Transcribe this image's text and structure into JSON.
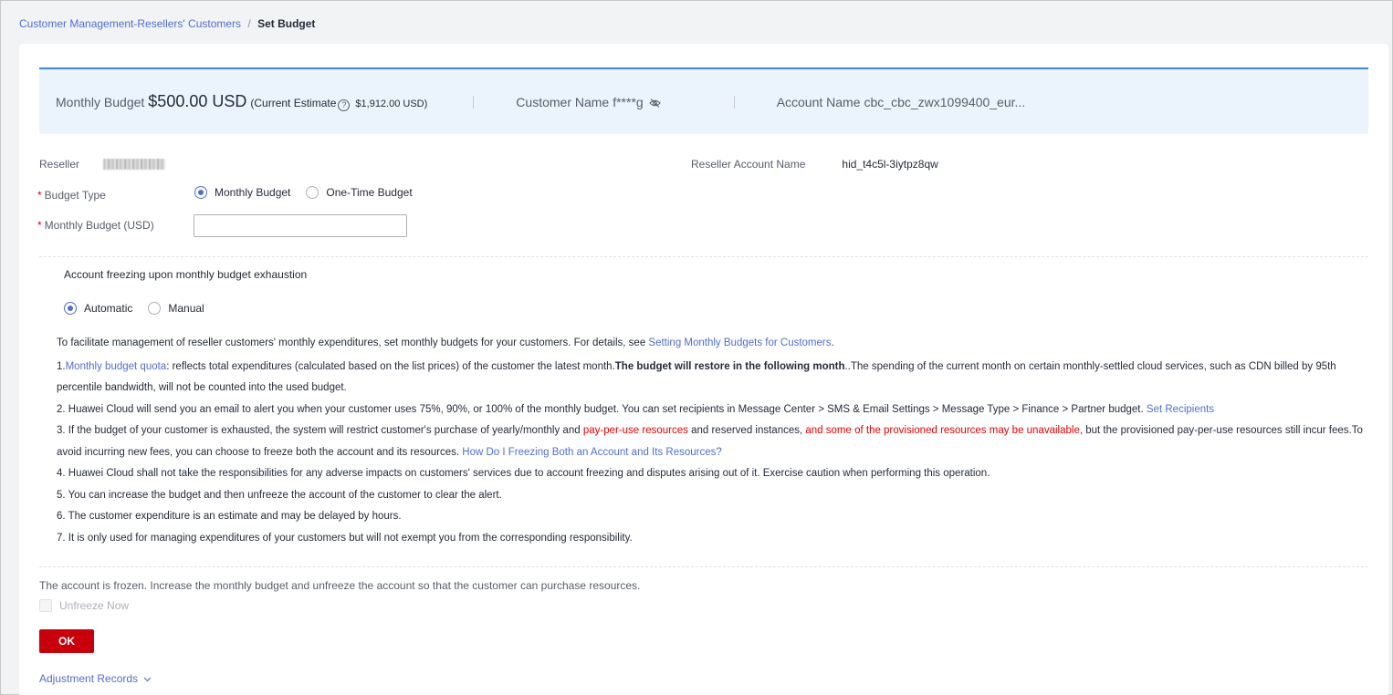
{
  "breadcrumb": {
    "parent": "Customer Management-Resellers' Customers",
    "separator": "/",
    "current": "Set Budget"
  },
  "summary": {
    "monthly_budget_label": "Monthly Budget",
    "monthly_budget_value": "$500.00 USD",
    "current_estimate_label": "(Current Estimate",
    "current_estimate_value": "$1,912.00 USD)",
    "customer_name_label": "Customer Name",
    "customer_name_value": "f****g",
    "account_name_label": "Account Name",
    "account_name_value": "cbc_cbc_zwx1099400_eur..."
  },
  "form": {
    "reseller_label": "Reseller",
    "reseller_account_label": "Reseller Account Name",
    "reseller_account_value": "hid_t4c5l-3iytpz8qw",
    "budget_type_label": "Budget Type",
    "budget_type_options": [
      "Monthly Budget",
      "One-Time Budget"
    ],
    "budget_type_selected": "Monthly Budget",
    "monthly_budget_label": "Monthly Budget (USD)",
    "monthly_budget_value": "",
    "freeze_label": "Account freezing upon monthly budget exhaustion",
    "freeze_options": [
      "Automatic",
      "Manual"
    ],
    "freeze_selected": "Automatic"
  },
  "notes": {
    "intro": "To facilitate management of reseller customers' monthly expenditures, set monthly budgets for your customers. For details, see ",
    "intro_link": "Setting Monthly Budgets for Customers",
    "intro_end": ".",
    "n1_prefix": "1.",
    "n1_link": "Monthly budget quota",
    "n1_text": ": reflects total expenditures (calculated based on the list prices) of the customer the latest month.",
    "n1_bold": "The budget will restore in the following month",
    "n1_rest": "..The spending of the current month on certain monthly-settled cloud services, such as CDN billed by 95th percentile bandwidth, will not be counted into the used budget.",
    "n2_text": "2. Huawei Cloud will send you an email to alert you when your customer uses 75%, 90%, or 100% of the monthly budget. You can set recipients in Message Center > SMS & Email Settings > Message Type > Finance > Partner budget. ",
    "n2_link": "Set Recipients",
    "n3_a": "3. If the budget of your customer is exhausted, the system will restrict customer's purchase of yearly/monthly and ",
    "n3_red1": "pay-per-use resources",
    "n3_b": " and reserved instances, ",
    "n3_red2": "and some of the provisioned resources may be unavailable,",
    "n3_c": " but the provisioned pay-per-use resources still incur fees.To avoid incurring new fees, you can choose to freeze both the account and its resources. ",
    "n3_link": "How Do I Freezing Both an Account and Its Resources?",
    "n4": "4. Huawei Cloud shall not take the responsibilities for any adverse impacts on customers' services due to account freezing and disputes arising out of it. Exercise caution when performing this operation.",
    "n5": "5. You can increase the budget and then unfreeze the account of the customer to clear the alert.",
    "n6": "6. The customer expenditure is an estimate and may be delayed by hours.",
    "n7": "7. It is only used for managing expenditures of your customers but will not exempt you from the corresponding responsibility."
  },
  "footer": {
    "frozen_text": "The account is frozen. Increase the monthly budget and unfreeze the account so that the customer can purchase resources.",
    "unfreeze_label": "Unfreeze Now",
    "ok_label": "OK",
    "adjustment_records": "Adjustment Records"
  },
  "colors": {
    "accent": "#526ecc",
    "primary_button": "#c7000b",
    "warning_text": "#e60000",
    "summary_bg": "#ebf4fd",
    "summary_border": "#3b87e0"
  }
}
